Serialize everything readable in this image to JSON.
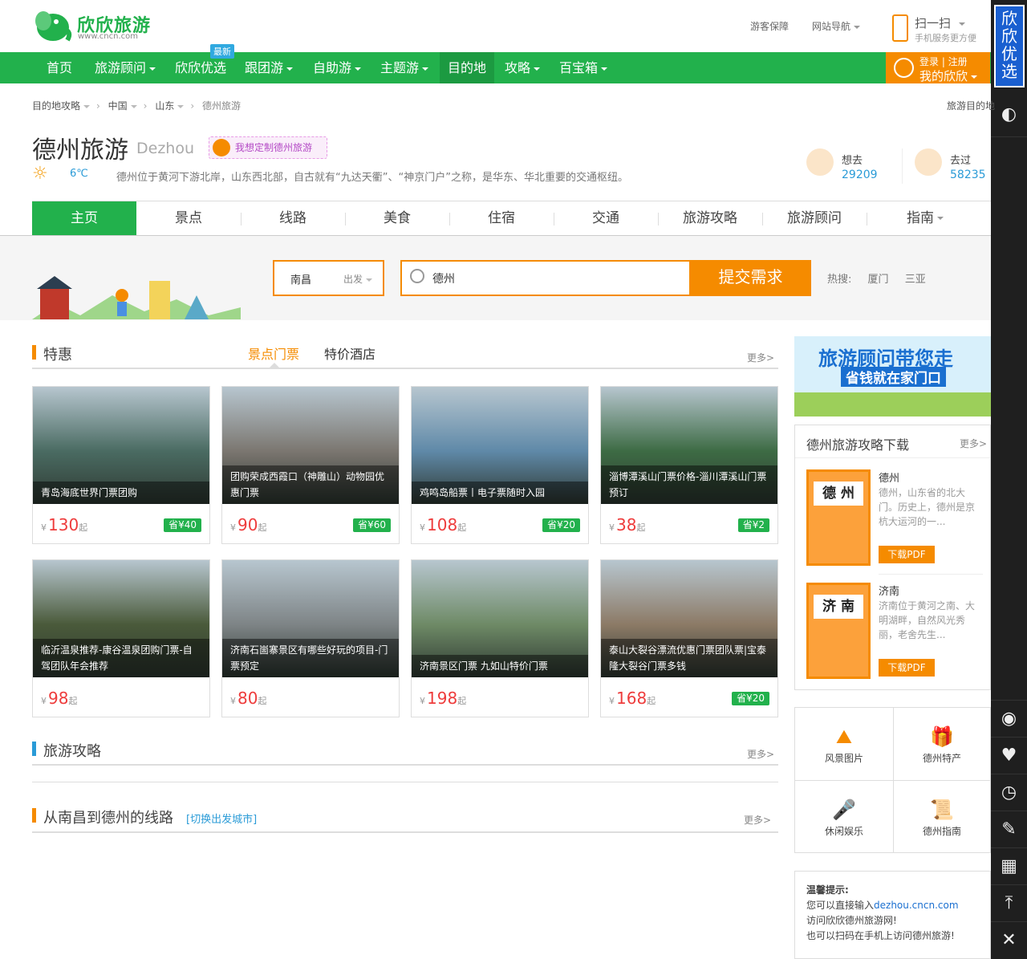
{
  "header": {
    "logo_name": "欣欣旅游",
    "logo_url": "www.cncn.com",
    "links": [
      "游客保障",
      "网站导航"
    ],
    "scan_title": "扫一扫",
    "scan_sub": "手机服务更方便"
  },
  "nav": {
    "items": [
      "首页",
      "旅游顾问",
      "欣欣优选",
      "跟团游",
      "自助游",
      "主题游",
      "目的地",
      "攻略",
      "百宝箱"
    ],
    "active": "目的地",
    "new_badge": "最新",
    "login": "登录 | 注册",
    "my": "我的欣欣"
  },
  "sidebar": {
    "promo": "欣欣优选"
  },
  "breadcrumb": [
    "目的地攻略",
    "中国",
    "山东",
    "德州旅游"
  ],
  "breadcrumb_right": "旅游目的地",
  "dest": {
    "title": "德州旅游",
    "title_en": "Dezhou",
    "custom": "我想定制德州旅游",
    "temp": "6℃",
    "desc": "德州位于黄河下游北岸，山东西北部，自古就有“九达天衢”、“神京门户”之称，是华东、华北重要的交通枢纽。",
    "want_label": "想去",
    "want_count": "29209",
    "been_label": "去过",
    "been_count": "58235"
  },
  "tabs": [
    "主页",
    "景点",
    "线路",
    "美食",
    "住宿",
    "交通",
    "旅游攻略",
    "旅游顾问",
    "指南"
  ],
  "search": {
    "city": "南昌",
    "depart": "出发",
    "query": "德州",
    "submit": "提交需求",
    "hot_label": "热搜:",
    "hot": [
      "厦门",
      "三亚"
    ]
  },
  "deals": {
    "title": "特惠",
    "tab1": "景点门票",
    "tab2": "特价酒店",
    "more": "更多>",
    "currency": "¥",
    "unit": "起",
    "cards": [
      {
        "name": "青岛海底世界门票团购",
        "price": "130",
        "save": "省¥40",
        "color": "#4a6b62"
      },
      {
        "name": "团购荣成西霞口（神雕山）动物园优惠门票",
        "price": "90",
        "save": "省¥60",
        "color": "#7b7670"
      },
      {
        "name": "鸡鸣岛船票丨电子票随时入园",
        "price": "108",
        "save": "省¥20",
        "color": "#5f89a8"
      },
      {
        "name": "淄博潭溪山门票价格-淄川潭溪山门票预订",
        "price": "38",
        "save": "省¥2",
        "color": "#3d6b44"
      },
      {
        "name": "临沂温泉推荐-康谷温泉团购门票-自驾团队年会推荐",
        "price": "98",
        "save": "",
        "color": "#4a5a3a"
      },
      {
        "name": "济南石崮寨景区有哪些好玩的项目-门票预定",
        "price": "80",
        "save": "",
        "color": "#7e8486"
      },
      {
        "name": "济南景区门票 九如山特价门票",
        "price": "198",
        "save": "",
        "color": "#6e8a66"
      },
      {
        "name": "泰山大裂谷漂流优惠门票团队票|宝泰隆大裂谷门票多钱",
        "price": "168",
        "save": "省¥20",
        "color": "#8c7a66"
      }
    ]
  },
  "strategy": {
    "title": "旅游攻略",
    "more": "更多>"
  },
  "routes": {
    "title": "从南昌到德州的线路",
    "switch": "[切换出发城市]",
    "more": "更多>"
  },
  "banner": {
    "line1": "旅游顾问带您走",
    "line2": "省钱就在家门口"
  },
  "download": {
    "title": "德州旅游攻略下载",
    "more": "更多>",
    "guides": [
      {
        "cover": "德 州",
        "name": "德州",
        "text": "德州，山东省的北大门。历史上，德州是京杭大运河的一...",
        "btn": "下载PDF"
      },
      {
        "cover": "济 南",
        "name": "济南",
        "text": "济南位于黄河之南、大明湖畔，自然风光秀丽，老舍先生...",
        "btn": "下载PDF"
      }
    ]
  },
  "quick": [
    "风景图片",
    "德州特产",
    "休闲娱乐",
    "德州指南"
  ],
  "tip": {
    "title": "温馨提示:",
    "line1a": "您可以直接输入",
    "line1b": "dezhou.cncn.com",
    "line2": "访问欣欣德州旅游网!",
    "line3": "也可以扫码在手机上访问德州旅游!"
  },
  "colors": {
    "green": "#22b14c",
    "orange": "#f58b00",
    "blue": "#2a9bd7",
    "red": "#ee3c3c"
  }
}
